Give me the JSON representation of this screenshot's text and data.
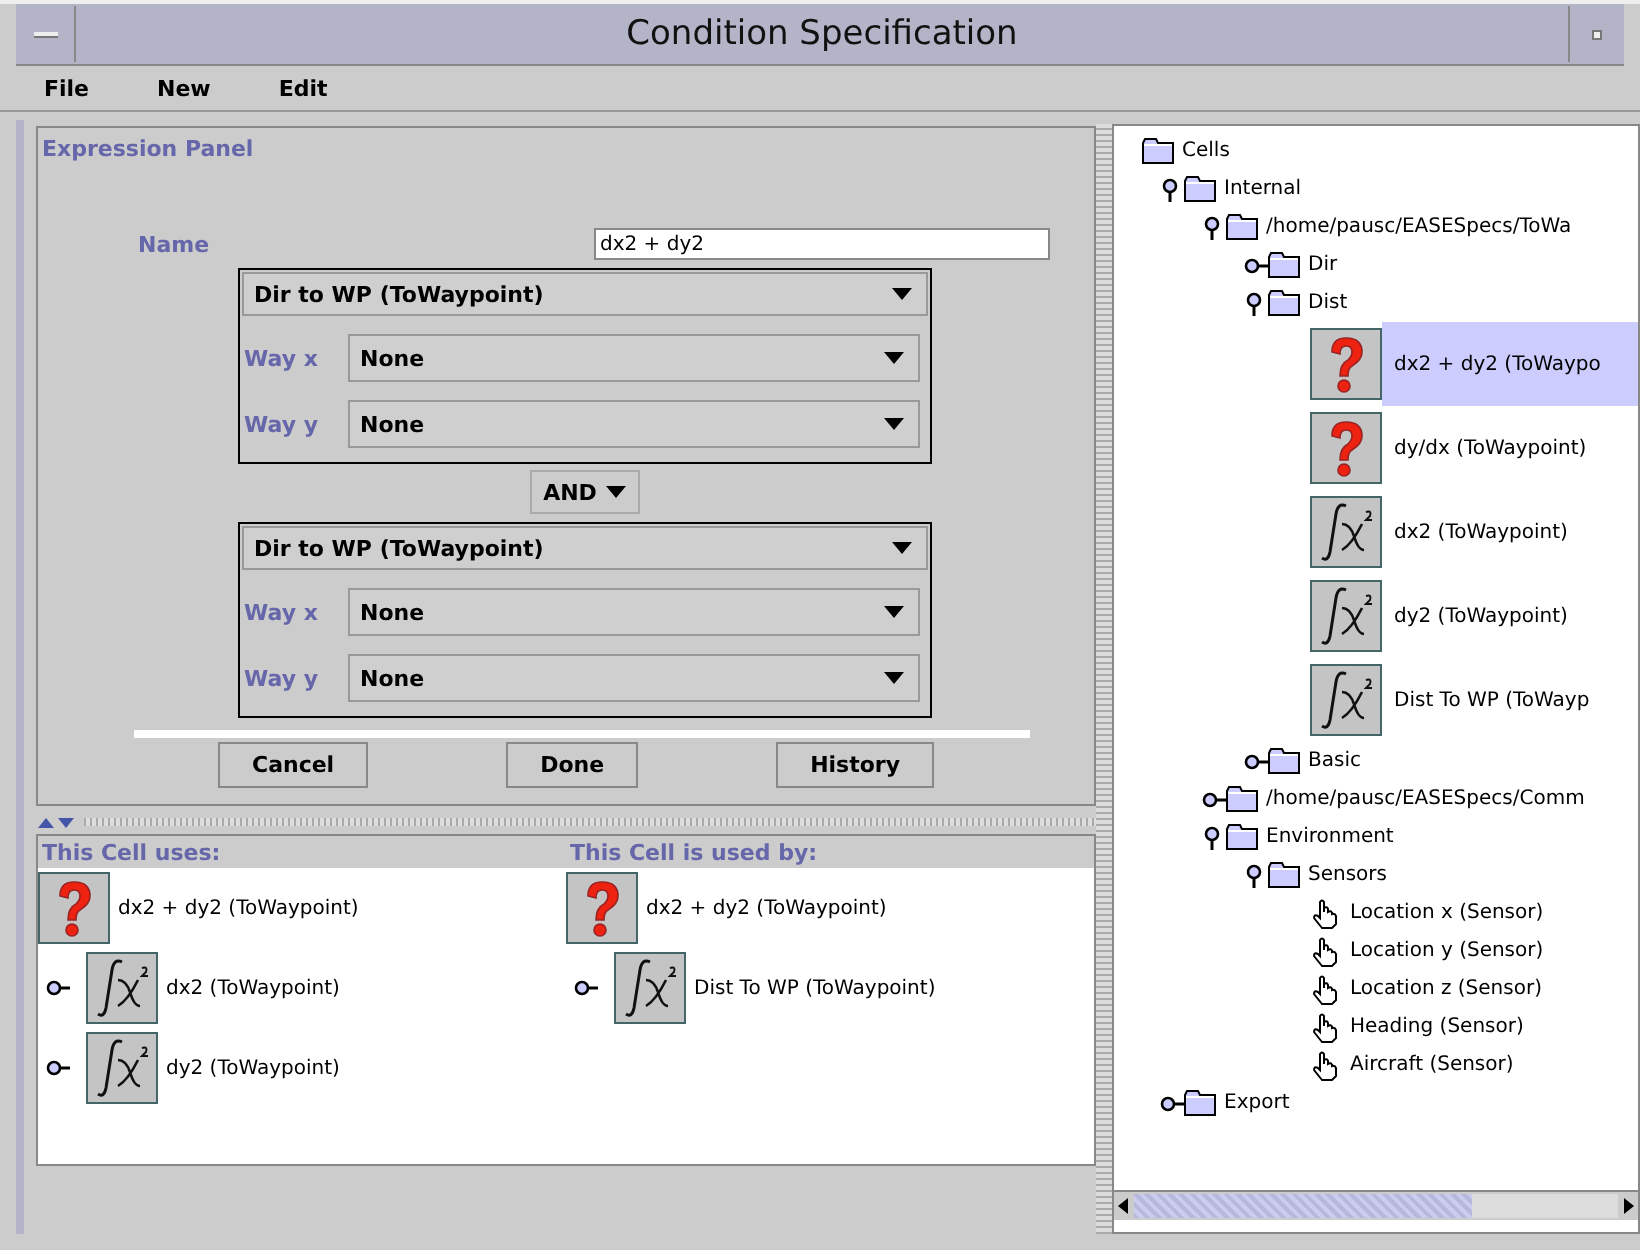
{
  "window": {
    "title": "Condition Specification"
  },
  "menu": [
    "File",
    "New",
    "Edit"
  ],
  "expression_panel": {
    "title": "Expression Panel",
    "name_label": "Name",
    "name_value": "dx2 + dy2",
    "conditions": [
      {
        "cell": "Dir to WP (ToWaypoint)",
        "params": [
          {
            "label": "Way x",
            "value": "None"
          },
          {
            "label": "Way y",
            "value": "None"
          }
        ]
      },
      {
        "cell": "Dir to WP (ToWaypoint)",
        "params": [
          {
            "label": "Way x",
            "value": "None"
          },
          {
            "label": "Way y",
            "value": "None"
          }
        ]
      }
    ],
    "operator": "AND",
    "buttons": [
      "Cancel",
      "Done",
      "History"
    ]
  },
  "dependencies": [
    {
      "title": "This Cell uses:",
      "items": [
        {
          "kind": "question",
          "label": "dx2 + dy2 (ToWaypoint)"
        },
        {
          "kind": "formula",
          "label": "dx2 (ToWaypoint)",
          "expanded": false
        },
        {
          "kind": "formula",
          "label": "dy2 (ToWaypoint)",
          "expanded": false
        }
      ]
    },
    {
      "title": "This Cell is used by:",
      "items": [
        {
          "kind": "question",
          "label": "dx2 + dy2 (ToWaypoint)"
        },
        {
          "kind": "formula",
          "label": "Dist To WP (ToWaypoint)",
          "expanded": false
        }
      ]
    }
  ],
  "tree": [
    {
      "kind": "folder",
      "label": "Cells",
      "selected": false,
      "children": [
        {
          "kind": "folder",
          "label": "Internal",
          "expanded": true,
          "selected": false,
          "children": [
            {
              "kind": "folder",
              "label": "/home/pausc/EASESpecs/ToWa",
              "expanded": true,
              "selected": false,
              "children": [
                {
                  "kind": "folder",
                  "label": "Dir",
                  "expanded": false,
                  "selected": false
                },
                {
                  "kind": "folder",
                  "label": "Dist",
                  "expanded": true,
                  "selected": false,
                  "children": [
                    {
                      "kind": "question",
                      "label": "dx2 + dy2 (ToWaypo",
                      "selected": true
                    },
                    {
                      "kind": "question",
                      "label": "dy/dx (ToWaypoint)",
                      "selected": false
                    },
                    {
                      "kind": "formula",
                      "label": "dx2 (ToWaypoint)",
                      "selected": false
                    },
                    {
                      "kind": "formula",
                      "label": "dy2 (ToWaypoint)",
                      "selected": false
                    },
                    {
                      "kind": "formula",
                      "label": "Dist To WP (ToWayp",
                      "selected": false
                    }
                  ]
                },
                {
                  "kind": "folder",
                  "label": "Basic",
                  "expanded": false,
                  "selected": false
                }
              ]
            },
            {
              "kind": "folder",
              "label": "/home/pausc/EASESpecs/Comm",
              "expanded": false,
              "selected": false
            },
            {
              "kind": "folder",
              "label": "Environment",
              "expanded": true,
              "selected": false,
              "children": [
                {
                  "kind": "folder",
                  "label": "Sensors",
                  "expanded": true,
                  "selected": false,
                  "children": [
                    {
                      "kind": "sensor",
                      "label": "Location x (Sensor)",
                      "selected": false
                    },
                    {
                      "kind": "sensor",
                      "label": "Location y (Sensor)",
                      "selected": false
                    },
                    {
                      "kind": "sensor",
                      "label": "Location z (Sensor)",
                      "selected": false
                    },
                    {
                      "kind": "sensor",
                      "label": "Heading (Sensor)",
                      "selected": false
                    },
                    {
                      "kind": "sensor",
                      "label": "Aircraft (Sensor)",
                      "selected": false
                    }
                  ]
                }
              ]
            }
          ]
        },
        {
          "kind": "folder",
          "label": "Export",
          "expanded": false,
          "selected": false
        }
      ]
    }
  ]
}
